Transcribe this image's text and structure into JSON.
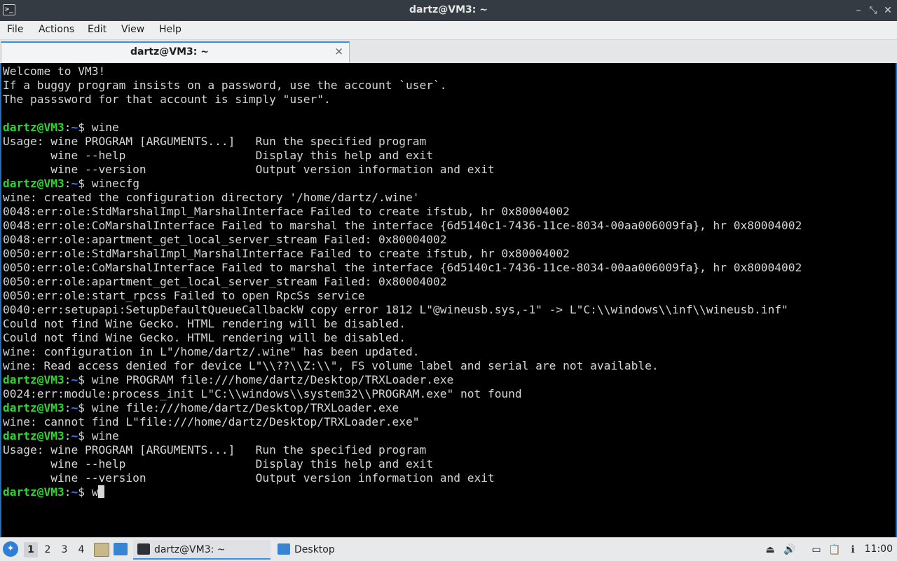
{
  "window": {
    "title": "dartz@VM3: ~",
    "buttons": {
      "minimize": "–",
      "maximize": "⤡",
      "close": "✕"
    }
  },
  "menu": [
    "File",
    "Actions",
    "Edit",
    "View",
    "Help"
  ],
  "tab": {
    "label": "dartz@VM3: ~",
    "close": "×"
  },
  "prompt": {
    "user": "dartz@VM3",
    "sep": ":",
    "path": "~",
    "sym": "$ "
  },
  "terminal": {
    "lines": [
      {
        "text": "Welcome to VM3!"
      },
      {
        "text": "If a buggy program insists on a password, use the account `user`."
      },
      {
        "text": "The passsword for that account is simply \"user\"."
      },
      {
        "text": ""
      },
      {
        "prompt": true,
        "text": "wine"
      },
      {
        "text": "Usage: wine PROGRAM [ARGUMENTS...]   Run the specified program"
      },
      {
        "text": "       wine --help                   Display this help and exit"
      },
      {
        "text": "       wine --version                Output version information and exit"
      },
      {
        "prompt": true,
        "text": "winecfg"
      },
      {
        "text": "wine: created the configuration directory '/home/dartz/.wine'"
      },
      {
        "text": "0048:err:ole:StdMarshalImpl_MarshalInterface Failed to create ifstub, hr 0x80004002"
      },
      {
        "text": "0048:err:ole:CoMarshalInterface Failed to marshal the interface {6d5140c1-7436-11ce-8034-00aa006009fa}, hr 0x80004002"
      },
      {
        "text": "0048:err:ole:apartment_get_local_server_stream Failed: 0x80004002"
      },
      {
        "text": "0050:err:ole:StdMarshalImpl_MarshalInterface Failed to create ifstub, hr 0x80004002"
      },
      {
        "text": "0050:err:ole:CoMarshalInterface Failed to marshal the interface {6d5140c1-7436-11ce-8034-00aa006009fa}, hr 0x80004002"
      },
      {
        "text": "0050:err:ole:apartment_get_local_server_stream Failed: 0x80004002"
      },
      {
        "text": "0050:err:ole:start_rpcss Failed to open RpcSs service"
      },
      {
        "text": "0040:err:setupapi:SetupDefaultQueueCallbackW copy error 1812 L\"@wineusb.sys,-1\" -> L\"C:\\\\windows\\\\inf\\\\wineusb.inf\""
      },
      {
        "text": "Could not find Wine Gecko. HTML rendering will be disabled."
      },
      {
        "text": "Could not find Wine Gecko. HTML rendering will be disabled."
      },
      {
        "text": "wine: configuration in L\"/home/dartz/.wine\" has been updated."
      },
      {
        "text": "wine: Read access denied for device L\"\\\\??\\\\Z:\\\\\", FS volume label and serial are not available."
      },
      {
        "prompt": true,
        "text": "wine PROGRAM file:///home/dartz/Desktop/TRXLoader.exe"
      },
      {
        "text": "0024:err:module:process_init L\"C:\\\\windows\\\\system32\\\\PROGRAM.exe\" not found"
      },
      {
        "prompt": true,
        "text": "wine file:///home/dartz/Desktop/TRXLoader.exe"
      },
      {
        "text": "wine: cannot find L\"file:///home/dartz/Desktop/TRXLoader.exe\""
      },
      {
        "prompt": true,
        "text": "wine"
      },
      {
        "text": "Usage: wine PROGRAM [ARGUMENTS...]   Run the specified program"
      },
      {
        "text": "       wine --help                   Display this help and exit"
      },
      {
        "text": "       wine --version                Output version information and exit"
      },
      {
        "prompt": true,
        "text": "w",
        "cursor": true
      }
    ]
  },
  "taskbar": {
    "start_icon": "lxqt-start-icon",
    "workspaces": [
      "1",
      "2",
      "3",
      "4"
    ],
    "active_workspace": "1",
    "tasks": [
      {
        "label": "dartz@VM3: ~",
        "icon": "terminal-icon",
        "active": true
      },
      {
        "label": "Desktop",
        "icon": "folder-icon",
        "active": false
      }
    ],
    "clock": "11:00"
  }
}
